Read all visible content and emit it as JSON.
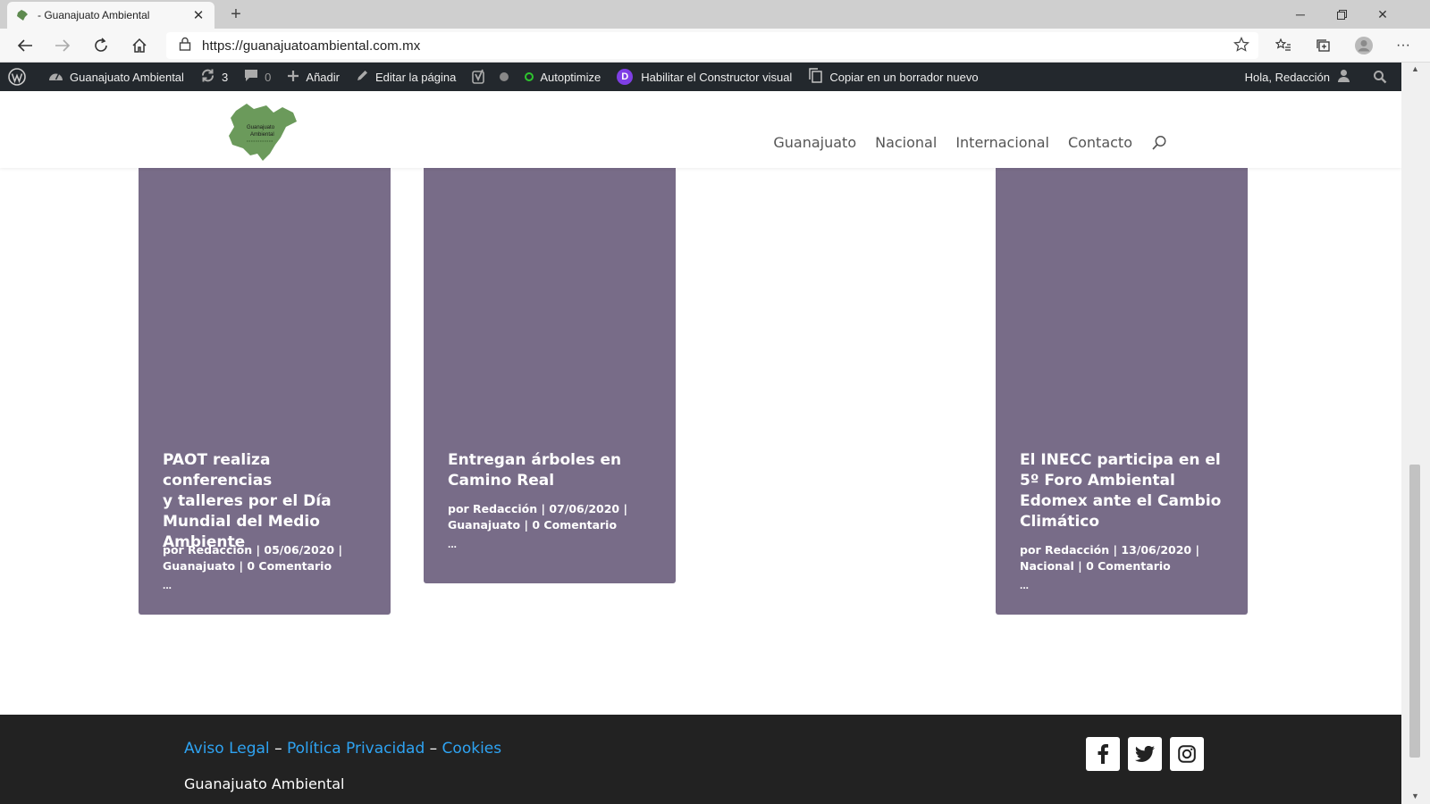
{
  "browser": {
    "tab_title": "- Guanajuato Ambiental",
    "url": "https://guanajuatoambiental.com.mx"
  },
  "adminbar": {
    "site_name": "Guanajuato Ambiental",
    "updates_count": "3",
    "comments_count": "0",
    "add_new": "Añadir",
    "edit_page": "Editar la página",
    "autoptimize": "Autoptimize",
    "divi_builder": "Habilitar el Constructor visual",
    "copy_draft": "Copiar en un borrador nuevo",
    "greeting": "Hola, Redacción"
  },
  "site": {
    "logo_text_1": "Guanajuato",
    "logo_text_2": "Ambiental",
    "nav": [
      "Guanajuato",
      "Nacional",
      "Internacional",
      "Contacto"
    ]
  },
  "posts": [
    {
      "title_lines": [
        "PAOT realiza conferencias",
        "y talleres por el Día",
        "Mundial del Medio",
        "Ambiente"
      ],
      "meta_line1": "por Redacción | 05/06/2020 |",
      "meta_line2": "Guanajuato | 0 Comentario",
      "excerpt": "..."
    },
    {
      "title_lines": [
        "Entregan árboles en",
        "Camino Real"
      ],
      "meta_line1": "por Redacción | 07/06/2020 |",
      "meta_line2": "Guanajuato | 0 Comentario",
      "excerpt": "..."
    },
    {
      "title_lines": [
        "El INECC participa en el",
        "5º Foro Ambiental",
        "Edomex ante el Cambio",
        "Climático"
      ],
      "meta_line1": "por Redacción | 13/06/2020 |",
      "meta_line2": "Nacional | 0 Comentario",
      "excerpt": "..."
    }
  ],
  "footer": {
    "aviso_legal": "Aviso Legal",
    "sep": "–",
    "privacidad": "Política Privacidad",
    "cookies": "Cookies",
    "copyright": "Guanajuato Ambiental"
  },
  "colors": {
    "card_bg": "#786c88",
    "footer_bg": "#222222",
    "link": "#2ea3f2",
    "adminbar_bg": "#23282d"
  }
}
